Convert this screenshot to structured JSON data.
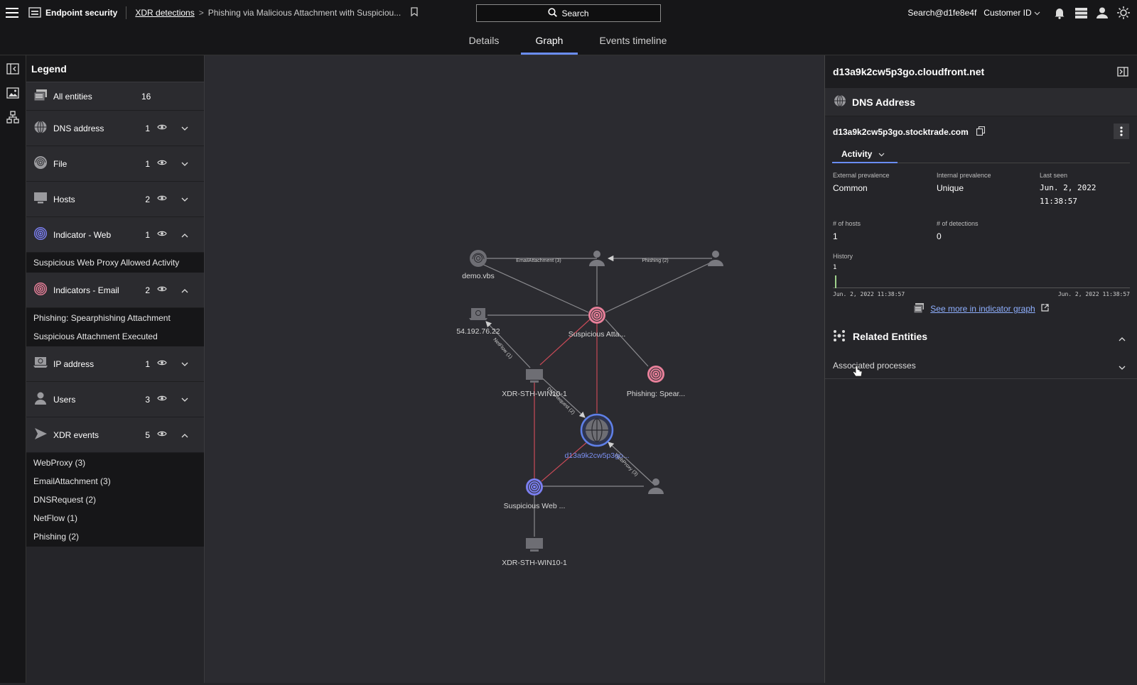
{
  "topbar": {
    "app_name": "Endpoint security",
    "breadcrumb_parent": "XDR detections",
    "breadcrumb_current": "Phishing via Malicious Attachment with Suspiciou...",
    "search_label": "Search",
    "user": "Search@d1fe8e4f",
    "customer": "Customer ID"
  },
  "tabs": [
    {
      "label": "Details"
    },
    {
      "label": "Graph"
    },
    {
      "label": "Events timeline"
    }
  ],
  "legend": {
    "title": "Legend",
    "all": {
      "label": "All entities",
      "count": "16"
    },
    "rows": [
      {
        "label": "DNS address",
        "count": "1"
      },
      {
        "label": "File",
        "count": "1"
      },
      {
        "label": "Hosts",
        "count": "2"
      },
      {
        "label": "Indicator - Web",
        "count": "1"
      },
      {
        "label": "Indicators - Email",
        "count": "2"
      },
      {
        "label": "IP address",
        "count": "1"
      },
      {
        "label": "Users",
        "count": "3"
      },
      {
        "label": "XDR events",
        "count": "5"
      }
    ],
    "web_items": [
      "Suspicious Web Proxy Allowed Activity"
    ],
    "email_items": [
      "Phishing: Spearphishing Attachment",
      "Suspicious Attachment Executed"
    ],
    "xdr_items": [
      "WebProxy (3)",
      "EmailAttachment (3)",
      "DNSRequest (2)",
      "NetFlow (1)",
      "Phishing (2)"
    ]
  },
  "graph": {
    "nodes": {
      "file": "demo.vbs",
      "ip": "54.192.76.22",
      "susp_attach": "Suspicious Atta...",
      "host1": "XDR-STH-WIN10-1",
      "phishing": "Phishing: Spear...",
      "dns": "d13a9k2cw5p3go...",
      "web": "Suspicious Web ...",
      "host2": "XDR-STH-WIN10-1"
    },
    "edges": {
      "email_attachment": "EmailAttachment (3)",
      "phishing": "Phishing (2)",
      "netflow": "NetFlow (1)",
      "dnsrequest": "DNSRequest (2)",
      "webproxy": "WebProxy (3)"
    }
  },
  "panel": {
    "title": "d13a9k2cw5p3go.cloudfront.net",
    "section": "DNS Address",
    "entity": "d13a9k2cw5p3go.stocktrade.com",
    "activity_tab": "Activity",
    "external_prevalence_label": "External prevalence",
    "external_prevalence": "Common",
    "internal_prevalence_label": "Internal prevalence",
    "internal_prevalence": "Unique",
    "last_seen_label": "Last seen",
    "last_seen_date": "Jun. 2, 2022",
    "last_seen_time": "11:38:57",
    "hosts_label": "# of hosts",
    "hosts": "1",
    "detections_label": "# of detections",
    "detections": "0",
    "history_label": "History",
    "history_y": "1",
    "history_start": "Jun. 2, 2022 11:38:57",
    "history_end": "Jun. 2, 2022 11:38:57",
    "see_more": "See more in indicator graph",
    "related_title": "Related Entities",
    "associated": "Associated processes"
  },
  "colors": {
    "accent": "#6a8df5",
    "email_indicator": "#e8809a",
    "web_indicator": "#7b7ff0",
    "edge_red": "#c84a57",
    "background": "#252529"
  }
}
